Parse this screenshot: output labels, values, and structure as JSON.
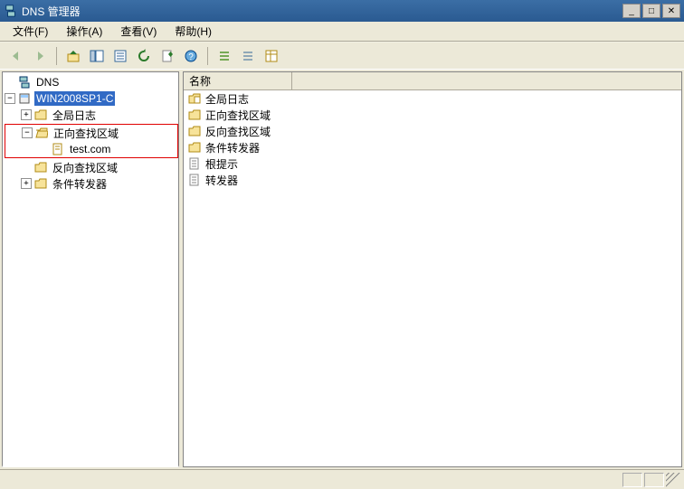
{
  "window": {
    "title": "DNS 管理器"
  },
  "menu": {
    "file": "文件(F)",
    "action": "操作(A)",
    "view": "查看(V)",
    "help": "帮助(H)"
  },
  "toolbar_icons": {
    "back": "back-arrow-icon",
    "forward": "forward-arrow-icon",
    "up": "up-folder-icon",
    "show_hide": "show-hide-tree-icon",
    "props": "properties-icon",
    "refresh": "refresh-icon",
    "export": "export-list-icon",
    "help": "help-icon",
    "list": "list-view-icon",
    "detail": "detail-view-icon",
    "icons": "icon-view-icon"
  },
  "tree": {
    "root": "DNS",
    "server": "WIN2008SP1-C",
    "global_log": "全局日志",
    "fwd_zone": "正向查找区域",
    "zone_item": "test.com",
    "rev_zone": "反向查找区域",
    "cond_fwd": "条件转发器"
  },
  "list_header": {
    "name": "名称"
  },
  "list_items": [
    {
      "icon": "folder-log",
      "label": "全局日志"
    },
    {
      "icon": "folder",
      "label": "正向查找区域"
    },
    {
      "icon": "folder",
      "label": "反向查找区域"
    },
    {
      "icon": "folder",
      "label": "条件转发器"
    },
    {
      "icon": "page",
      "label": "根提示"
    },
    {
      "icon": "page",
      "label": "转发器"
    }
  ],
  "expanders": {
    "minus": "−",
    "plus": "+"
  }
}
